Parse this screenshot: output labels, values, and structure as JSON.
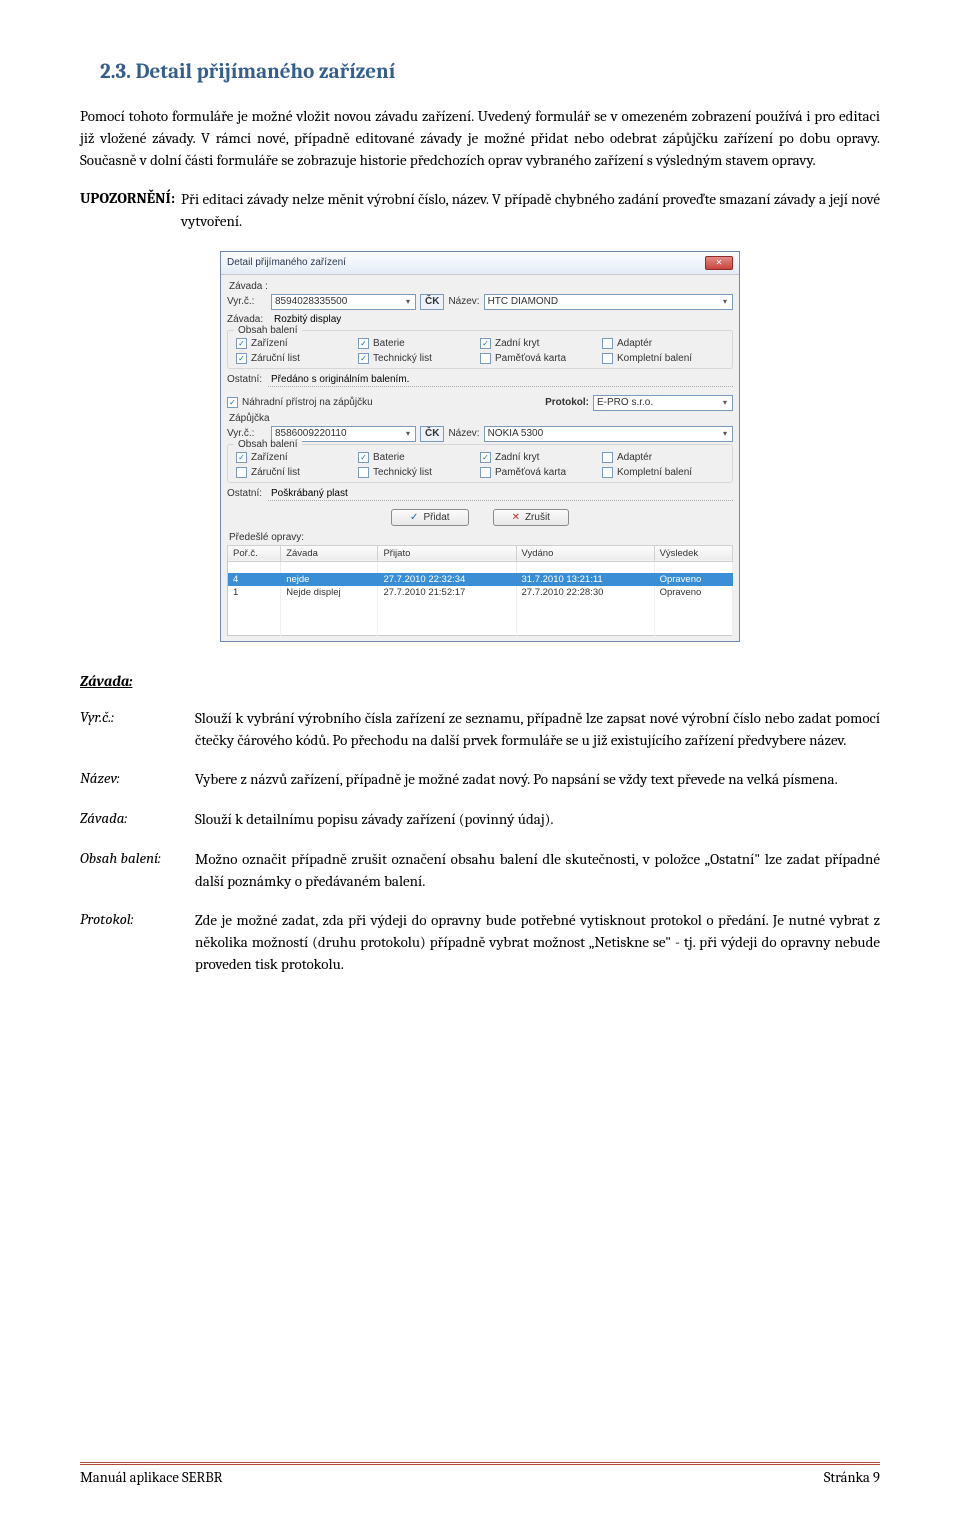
{
  "heading": "2.3. Detail přijímaného zařízení",
  "para1": "Pomocí tohoto formuláře je možné vložit novou závadu zařízení. Uvedený formulář se v omezeném zobrazení používá i pro editaci již vložené závady. V rámci nové, případně editované závady je možné přidat nebo odebrat zápůjčku zařízení po dobu opravy. Současně v dolní části formuláře se zobrazuje historie předchozích oprav vybraného zařízení s výsledným stavem opravy.",
  "warn_label": "UPOZORNĚNÍ:",
  "warn_text": "Při editaci závady nelze měnit výrobní číslo, název. V případě chybného zadání proveďte smazaní závady a její nové vytvoření.",
  "dialog": {
    "title": "Detail přijímaného zařízení",
    "zavada_section": "Závada :",
    "vyrc_label": "Vyr.č.:",
    "vyrc_value": "8594028335500",
    "ck_label": "ČK",
    "nazev_label": "Název:",
    "nazev_value": "HTC DIAMOND",
    "zavada_label": "Závada:",
    "zavada_value": "Rozbitý display",
    "obsah_title": "Obsah balení",
    "cb_items": [
      {
        "label": "Zařízení",
        "checked": true
      },
      {
        "label": "Baterie",
        "checked": true
      },
      {
        "label": "Zadní kryt",
        "checked": true
      },
      {
        "label": "Adaptér",
        "checked": false
      },
      {
        "label": "Záruční list",
        "checked": true
      },
      {
        "label": "Technický list",
        "checked": true
      },
      {
        "label": "Paměťová karta",
        "checked": false
      },
      {
        "label": "Kompletní balení",
        "checked": false
      }
    ],
    "ostatni_label": "Ostatní:",
    "ostatni_value": "Předáno s originálním balením.",
    "nahrad_cb": "Náhradní přístroj na zápůjčku",
    "protokol_label": "Protokol:",
    "protokol_value": "E-PRO s.r.o.",
    "zapujcka_label": "Zápůjčka",
    "vyrc2_value": "8586009220110",
    "nazev2_value": "NOKIA 5300",
    "cb_items2": [
      {
        "label": "Zařízení",
        "checked": true
      },
      {
        "label": "Baterie",
        "checked": true
      },
      {
        "label": "Zadní kryt",
        "checked": true
      },
      {
        "label": "Adaptér",
        "checked": false
      },
      {
        "label": "Záruční list",
        "checked": false
      },
      {
        "label": "Technický list",
        "checked": false
      },
      {
        "label": "Paměťová karta",
        "checked": false
      },
      {
        "label": "Kompletní balení",
        "checked": false
      }
    ],
    "ostatni2_value": "Poškrábaný plast",
    "btn_add": "Přidat",
    "btn_cancel": "Zrušit",
    "predesle_label": "Předešlé opravy:",
    "table": {
      "headers": [
        "Poř.č.",
        "Závada",
        "Přijato",
        "Vydáno",
        "Výsledek"
      ],
      "rows": [
        {
          "cells": [
            "4",
            "nejde",
            "27.7.2010 22:32:34",
            "31.7.2010 13:21:11",
            "Opraveno"
          ],
          "selected": true
        },
        {
          "cells": [
            "1",
            "Nejde displej",
            "27.7.2010 21:52:17",
            "27.7.2010 22:28:30",
            "Opraveno"
          ],
          "selected": false
        }
      ]
    }
  },
  "defs_heading": "Závada:",
  "def_rows": [
    {
      "term": "Vyr.č.:",
      "desc": "Slouží k vybrání výrobního čísla zařízení ze seznamu, případně lze zapsat nové výrobní číslo nebo zadat pomocí čtečky čárového kódů. Po přechodu na další prvek formuláře se u již existujícího zařízení předvybere název."
    },
    {
      "term": "Název:",
      "desc": "Vybere z názvů zařízení, případně je možné zadat nový. Po napsání se vždy text převede na velká písmena."
    },
    {
      "term": "Závada:",
      "desc": "Slouží k detailnímu popisu závady zařízení (povinný údaj)."
    },
    {
      "term": "Obsah balení:",
      "desc": "Možno označit případně zrušit označení obsahu balení dle skutečnosti, v položce „Ostatní\" lze zadat případné další poznámky o předávaném balení."
    },
    {
      "term": "Protokol:",
      "desc": "Zde je možné zadat, zda při výdeji do opravny bude potřebné vytisknout protokol o předání. Je nutné vybrat z několika možností (druhu protokolu) případně vybrat možnost „Netiskne se\" - tj. při výdeji do opravny nebude proveden tisk protokolu."
    }
  ],
  "footer_left": "Manuál aplikace SERBR",
  "footer_right": "Stránka 9"
}
